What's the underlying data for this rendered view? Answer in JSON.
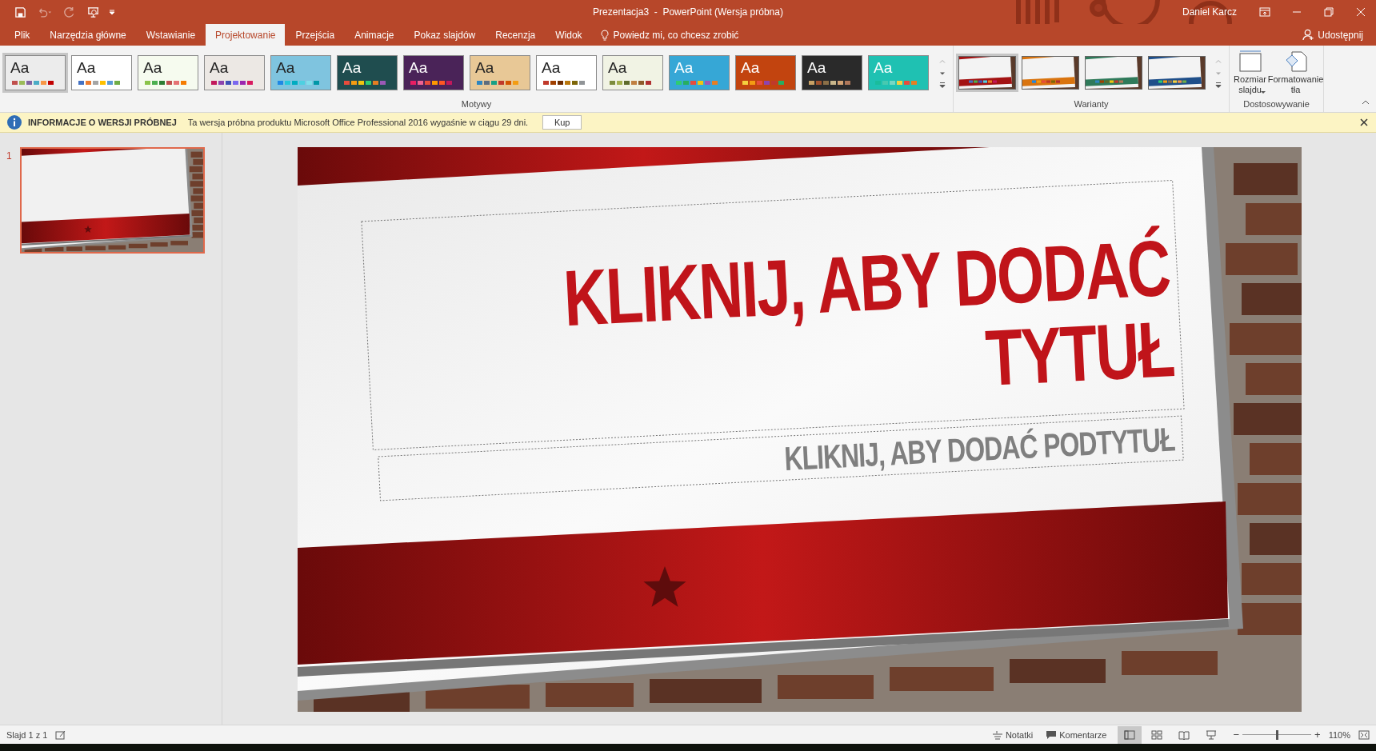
{
  "window": {
    "title": "Prezentacja3  -  PowerPoint (Wersja próbna)",
    "user": "Daniel Karcz"
  },
  "tabs": [
    {
      "label": "Plik",
      "selected": false
    },
    {
      "label": "Narzędzia główne",
      "selected": false
    },
    {
      "label": "Wstawianie",
      "selected": false
    },
    {
      "label": "Projektowanie",
      "selected": true
    },
    {
      "label": "Przejścia",
      "selected": false
    },
    {
      "label": "Animacje",
      "selected": false
    },
    {
      "label": "Pokaz slajdów",
      "selected": false
    },
    {
      "label": "Recenzja",
      "selected": false
    },
    {
      "label": "Widok",
      "selected": false
    }
  ],
  "tell_me": {
    "placeholder": "Powiedz mi, co chcesz zrobić"
  },
  "share": "Udostępnij",
  "ribbon": {
    "themes": {
      "label": "Motywy",
      "items": [
        {
          "label": "Aa",
          "selected": true,
          "color": "#ececec"
        },
        {
          "label": "Aa",
          "selected": false,
          "color": "#ffffff"
        },
        {
          "label": "Aa",
          "selected": false,
          "color": "#f6fbef"
        },
        {
          "label": "Aa",
          "selected": false,
          "color": "#ece8e4"
        },
        {
          "label": "Aa",
          "selected": false,
          "color": "#7fc4df"
        },
        {
          "label": "Aa",
          "selected": false,
          "color": "#1f4d4f"
        },
        {
          "label": "Aa",
          "selected": false,
          "color": "#4a2358"
        },
        {
          "label": "Aa",
          "selected": false,
          "color": "#e8c896"
        },
        {
          "label": "Aa",
          "selected": false,
          "color": "#ffffff"
        },
        {
          "label": "Aa",
          "selected": false,
          "color": "#f1f3e4"
        },
        {
          "label": "Aa",
          "selected": false,
          "color": "#36a7d6"
        },
        {
          "label": "Aa",
          "selected": false,
          "color": "#c2440f"
        },
        {
          "label": "Aa",
          "selected": false,
          "color": "#2a2a2a"
        },
        {
          "label": "Aa",
          "selected": false,
          "color": "#1fc1b2"
        }
      ]
    },
    "variants": {
      "label": "Warianty",
      "items": [
        {
          "selected": true,
          "color": "#a31212"
        },
        {
          "selected": false,
          "color": "#d9740f"
        },
        {
          "selected": false,
          "color": "#2f7a5a"
        },
        {
          "selected": false,
          "color": "#1f4f8a"
        }
      ]
    },
    "customize": {
      "label": "Dostosowywanie",
      "buttons": [
        {
          "label": "Rozmiar slajdu",
          "kind": "dropdown"
        },
        {
          "label": "Formatowanie tła",
          "kind": "plain"
        }
      ]
    }
  },
  "info_bar": {
    "title": "INFORMACJE O WERSJI PRÓBNEJ",
    "message": "Ta wersja próbna produktu Microsoft Office Professional 2016 wygaśnie w ciągu 29 dni.",
    "button": "Kup"
  },
  "slides_panel": [
    {
      "number": "1",
      "selected": true
    }
  ],
  "slide": {
    "title": "KLIKNIJ, ABY DODAĆ TYTUŁ",
    "subtitle": "KLIKNIJ, ABY DODAĆ PODTYTUŁ"
  },
  "status_bar": {
    "slide_info": "Slajd 1 z 1",
    "notes": "Notatki",
    "comments": "Komentarze",
    "views": [
      {
        "selected": true
      },
      {
        "selected": false
      },
      {
        "selected": false
      },
      {
        "selected": false
      }
    ],
    "zoom": {
      "out": "−",
      "in": "+",
      "level": 0.5,
      "reading": "110%"
    }
  }
}
